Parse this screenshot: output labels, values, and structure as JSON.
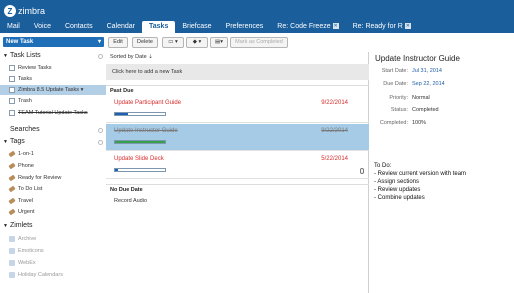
{
  "app": {
    "logo_text": "zimbra"
  },
  "tabs": [
    {
      "label": "Mail"
    },
    {
      "label": "Voice"
    },
    {
      "label": "Contacts"
    },
    {
      "label": "Calendar"
    },
    {
      "label": "Tasks"
    },
    {
      "label": "Briefcase"
    },
    {
      "label": "Preferences"
    },
    {
      "label": "Re: Code Freeze"
    },
    {
      "label": "Re: Ready for R"
    }
  ],
  "sidebar": {
    "new_task_label": "New Task",
    "sections": {
      "task_lists": "Task Lists",
      "searches": "Searches",
      "tags": "Tags",
      "zimlets": "Zimlets"
    },
    "task_lists": [
      {
        "label": "Review Tasks"
      },
      {
        "label": "Tasks"
      },
      {
        "label": "Zimbra 8.5 Update Tasks"
      },
      {
        "label": "Trash"
      },
      {
        "label": "TEAM Tutorial Update Tasks"
      }
    ],
    "tags": [
      {
        "label": "1-on-1"
      },
      {
        "label": "Phone"
      },
      {
        "label": "Ready for Review"
      },
      {
        "label": "To Do List"
      },
      {
        "label": "Travel"
      },
      {
        "label": "Urgent"
      }
    ],
    "zimlets": [
      {
        "label": "Archive"
      },
      {
        "label": "Emoticons"
      },
      {
        "label": "WebEx"
      },
      {
        "label": "Holiday Calendars"
      }
    ]
  },
  "toolbar": {
    "edit_label": "Edit",
    "delete_label": "Delete",
    "mark_completed_label": "Mark as Completed"
  },
  "tasklist": {
    "sort_label": "Sorted by Date",
    "add_task_placeholder": "Click here to add a new Task",
    "groups": {
      "past_due": "Past Due",
      "no_due_date": "No Due Date"
    },
    "tasks": [
      {
        "name": "Update Participant Guide",
        "date": "9/22/2014",
        "progress": 0.25
      },
      {
        "name": "Update Instructor Guide",
        "date": "9/22/2014",
        "progress": 1.0
      },
      {
        "name": "Update Slide Deck",
        "date": "5/22/2014",
        "progress": 0.05
      }
    ],
    "no_date_tasks": [
      {
        "name": "Record Audio"
      }
    ]
  },
  "detail": {
    "title": "Update Instructor Guide",
    "fields": [
      {
        "label": "Start Date:",
        "value": "Jul 31, 2014"
      },
      {
        "label": "Due Date:",
        "value": "Sep 22, 2014"
      },
      {
        "label": "Priority:",
        "value": "Normal"
      },
      {
        "label": "Status:",
        "value": "Completed"
      },
      {
        "label": "Completed:",
        "value": "100%"
      }
    ],
    "notes": [
      "To Do:",
      "- Review current version with team",
      "- Assign sections",
      "- Review updates",
      "- Combine updates"
    ]
  },
  "colors": {
    "header": "#1a5e9c",
    "selection": "#a6cbe6",
    "overdue": "#d62b2b",
    "progress_blue": "#1f5fb0",
    "progress_green": "#36a04a"
  }
}
